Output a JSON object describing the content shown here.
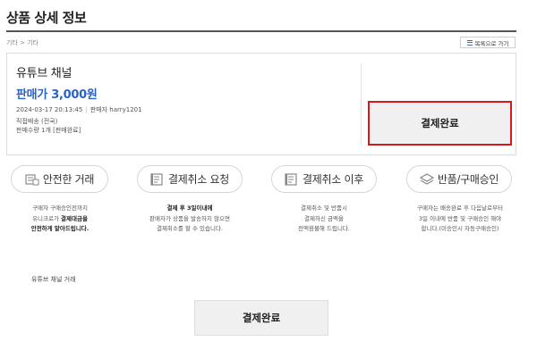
{
  "header": {
    "title": "상품 상세 정보"
  },
  "breadcrumb": "기타 > 기타",
  "list_button": {
    "label": "목록으로 가기"
  },
  "product": {
    "name": "유튜브 채널",
    "price": "판매가 3,000원",
    "datetime": "2024-03-17 20:13:45",
    "seller": "판매자 harry1201",
    "delivery": "직접배송 (전국)",
    "quantity": "판매수량 1개 [판매완료]"
  },
  "status_button": {
    "label": "결제완료"
  },
  "steps": [
    {
      "title": "안전한 거래",
      "icon": "safe-trade-icon",
      "lines": [
        "구매자 구매승인전까지",
        "유니크로가 ",
        "결제대금을",
        "안전하게 맡아드립니다."
      ]
    },
    {
      "title": "결제취소 요청",
      "icon": "cancel-request-icon",
      "lines": [
        "결제 후 3일이내에",
        "판매자가 상품을 발송하지 않으면",
        "결제취소를 할 수 있습니다."
      ]
    },
    {
      "title": "결제취소 이후",
      "icon": "after-cancel-icon",
      "lines": [
        "결제취소 및 반품시",
        "결제하신 금액을",
        "전액환불해 드립니다."
      ]
    },
    {
      "title": "반품/구매승인",
      "icon": "approval-icon",
      "lines": [
        "구매자는 배송완료 후 다음날로부터",
        "3일 이내에 반품 및 구매승인 해야",
        "합니다.(미승인시 자동구매승인)"
      ]
    }
  ],
  "bottom": {
    "label": "유튜브 채널 거래",
    "button_label": "결제완료"
  },
  "colors": {
    "accent_price": "#2a63c4",
    "highlight_border": "#d8191c"
  }
}
